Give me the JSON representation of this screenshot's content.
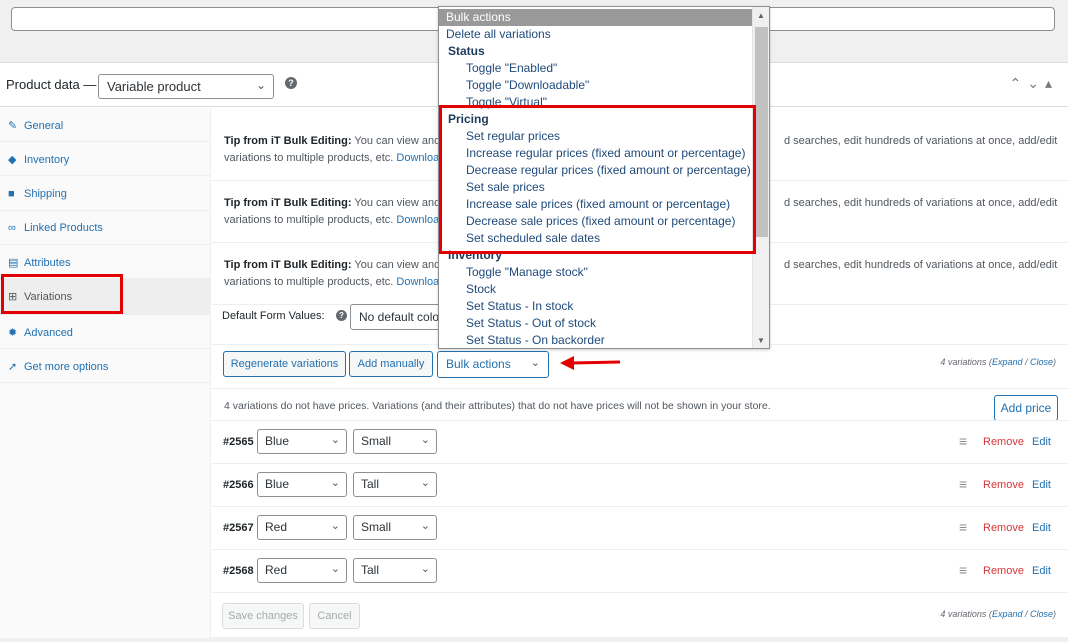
{
  "product_data": {
    "label": "Product data —",
    "type_select": "Variable product",
    "help_icon": "question-icon"
  },
  "sidebar": {
    "items": [
      {
        "label": "General",
        "icon": "wrench-icon",
        "glyph": "🔧"
      },
      {
        "label": "Inventory",
        "icon": "tag-icon",
        "glyph": "◈"
      },
      {
        "label": "Shipping",
        "icon": "truck-icon",
        "glyph": "■"
      },
      {
        "label": "Linked Products",
        "icon": "link-icon",
        "glyph": "∞"
      },
      {
        "label": "Attributes",
        "icon": "list-icon",
        "glyph": "▤"
      },
      {
        "label": "Variations",
        "icon": "grid-icon",
        "glyph": "⊞"
      },
      {
        "label": "Advanced",
        "icon": "gear-icon",
        "glyph": "✹"
      },
      {
        "label": "Get more options",
        "icon": "plugin-icon",
        "glyph": "➚"
      }
    ]
  },
  "tips": [
    {
      "bold": "Tip from iT Bulk Editing:",
      "text_start": " You can view and ed",
      "text_end": "d searches, edit hundreds of variations at once, add/edit",
      "line2": "variations to multiple products, etc. ",
      "link": "Downloa"
    },
    {
      "bold": "Tip from iT Bulk Editing:",
      "text_start": " You can view and ed",
      "text_end": "d searches, edit hundreds of variations at once, add/edit",
      "line2": "variations to multiple products, etc. ",
      "link": "Downloa"
    },
    {
      "bold": "Tip from iT Bulk Editing:",
      "text_start": " You can view and ed",
      "text_end": "d searches, edit hundreds of variations at once, add/edit",
      "line2": "variations to multiple products, etc. ",
      "link": "Downloa"
    }
  ],
  "default_form": {
    "label": "Default Form Values:",
    "select": "No default colo"
  },
  "toolbar": {
    "regenerate": "Regenerate variations",
    "add_manually": "Add manually",
    "bulk_actions": "Bulk actions",
    "count_text": "4 variations (",
    "expand": "Expand",
    "sep": " / ",
    "close": "Close",
    "close_paren": ")"
  },
  "notice": {
    "text": "4 variations do not have prices. Variations (and their attributes) that do not have prices will not be shown in your store.",
    "add_price": "Add price"
  },
  "variations": [
    {
      "id": "#2565",
      "color": "Blue",
      "size": "Small"
    },
    {
      "id": "#2566",
      "color": "Blue",
      "size": "Tall"
    },
    {
      "id": "#2567",
      "color": "Red",
      "size": "Small"
    },
    {
      "id": "#2568",
      "color": "Red",
      "size": "Tall"
    }
  ],
  "row_actions": {
    "remove": "Remove",
    "edit": "Edit"
  },
  "footer": {
    "save": "Save changes",
    "cancel": "Cancel",
    "count_text": "4 variations (",
    "expand": "Expand",
    "sep": " / ",
    "close": "Close",
    "close_paren": ")"
  },
  "dropdown": {
    "highlighted": "Bulk actions",
    "delete_all": "Delete all variations",
    "groups": {
      "status": "Status",
      "pricing": "Pricing",
      "inventory": "Inventory"
    },
    "status_items": [
      "Toggle \"Enabled\"",
      "Toggle \"Downloadable\"",
      "Toggle \"Virtual\""
    ],
    "pricing_items": [
      "Set regular prices",
      "Increase regular prices (fixed amount or percentage)",
      "Decrease regular prices (fixed amount or percentage)",
      "Set sale prices",
      "Increase sale prices (fixed amount or percentage)",
      "Decrease sale prices (fixed amount or percentage)",
      "Set scheduled sale dates"
    ],
    "inventory_items": [
      "Toggle \"Manage stock\"",
      "Stock",
      "Set Status - In stock",
      "Set Status - Out of stock",
      "Set Status - On backorder"
    ]
  },
  "annotations": {
    "highlight_color": "#e30000"
  }
}
